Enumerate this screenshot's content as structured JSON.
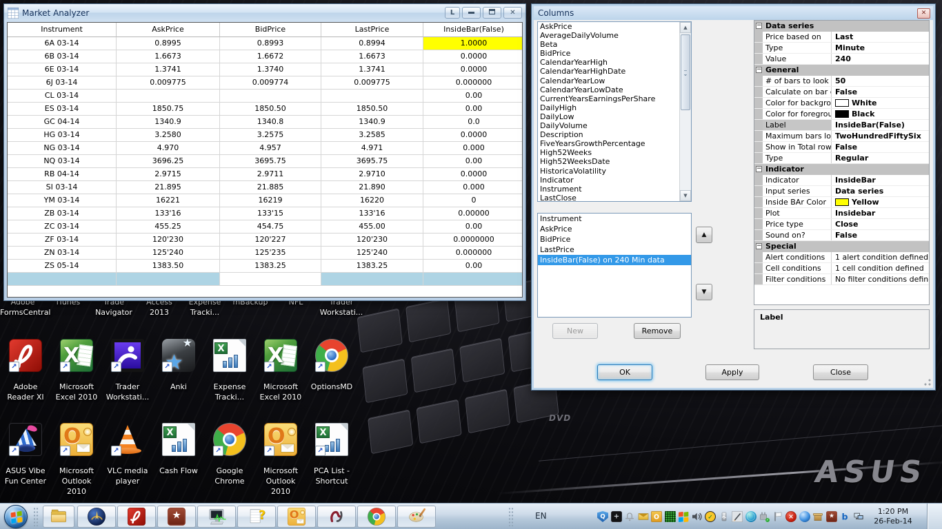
{
  "window": {
    "title": "Market Analyzer",
    "link_button_label": "L",
    "table": {
      "columns": [
        "Instrument",
        "AskPrice",
        "BidPrice",
        "LastPrice",
        "InsideBar(False)"
      ],
      "rows": [
        [
          "6A 03-14",
          "0.8995",
          "0.8993",
          "0.8994",
          "1.0000"
        ],
        [
          "6B 03-14",
          "1.6673",
          "1.6672",
          "1.6673",
          "0.0000"
        ],
        [
          "6E 03-14",
          "1.3741",
          "1.3740",
          "1.3741",
          "0.0000"
        ],
        [
          "6J 03-14",
          "0.009775",
          "0.009774",
          "0.009775",
          "0.000000"
        ],
        [
          "CL 03-14",
          "",
          "",
          "",
          "0.00"
        ],
        [
          "ES 03-14",
          "1850.75",
          "1850.50",
          "1850.50",
          "0.00"
        ],
        [
          "GC 04-14",
          "1340.9",
          "1340.8",
          "1340.9",
          "0.0"
        ],
        [
          "HG 03-14",
          "3.2580",
          "3.2575",
          "3.2585",
          "0.0000"
        ],
        [
          "NG 03-14",
          "4.970",
          "4.957",
          "4.971",
          "0.000"
        ],
        [
          "NQ 03-14",
          "3696.25",
          "3695.75",
          "3695.75",
          "0.00"
        ],
        [
          "RB 04-14",
          "2.9715",
          "2.9711",
          "2.9710",
          "0.0000"
        ],
        [
          "SI 03-14",
          "21.895",
          "21.885",
          "21.890",
          "0.000"
        ],
        [
          "YM 03-14",
          "16221",
          "16219",
          "16220",
          "0"
        ],
        [
          "ZB 03-14",
          "133'16",
          "133'15",
          "133'16",
          "0.00000"
        ],
        [
          "ZC 03-14",
          "455.25",
          "454.75",
          "455.00",
          "0.00"
        ],
        [
          "ZF 03-14",
          "120'230",
          "120'227",
          "120'230",
          "0.0000000"
        ],
        [
          "ZN 03-14",
          "125'240",
          "125'235",
          "125'240",
          "0.000000"
        ],
        [
          "ZS 05-14",
          "1383.50",
          "1383.25",
          "1383.25",
          "0.00"
        ]
      ],
      "highlight": {
        "row": 0,
        "col": 4,
        "color": "#ffff00"
      },
      "footer_blue_cols": [
        0,
        1,
        3,
        4
      ],
      "footer_color": "#aed4e4"
    }
  },
  "dialog": {
    "title": "Columns",
    "available_columns": [
      "AskPrice",
      "AverageDailyVolume",
      "Beta",
      "BidPrice",
      "CalendarYearHigh",
      "CalendarYearHighDate",
      "CalendarYearLow",
      "CalendarYearLowDate",
      "CurrentYearsEarningsPerShare",
      "DailyHigh",
      "DailyLow",
      "DailyVolume",
      "Description",
      "FiveYearsGrowthPercentage",
      "High52Weeks",
      "High52WeeksDate",
      "HistoricaVolatility",
      "Indicator",
      "Instrument",
      "LastClose"
    ],
    "selected_columns": [
      "Instrument",
      "AskPrice",
      "BidPrice",
      "LastPrice",
      "InsideBar(False) on 240 Min data"
    ],
    "selected_index": 4,
    "new_label": "New",
    "remove_label": "Remove",
    "ok_label": "OK",
    "apply_label": "Apply",
    "close_label": "Close",
    "description_title": "Label",
    "properties": [
      {
        "kind": "group",
        "name": "Data series"
      },
      {
        "kind": "prop",
        "name": "Price based on",
        "value": "Last",
        "bold": true
      },
      {
        "kind": "prop",
        "name": "Type",
        "value": "Minute",
        "bold": true
      },
      {
        "kind": "prop",
        "name": "Value",
        "value": "240",
        "bold": true
      },
      {
        "kind": "group",
        "name": "General"
      },
      {
        "kind": "prop",
        "name": "# of bars to look back",
        "value": "50",
        "bold": true
      },
      {
        "kind": "prop",
        "name": "Calculate on bar close",
        "value": "False",
        "bold": true
      },
      {
        "kind": "prop",
        "name": "Color for background",
        "value": "White",
        "bold": true,
        "swatch": "#ffffff"
      },
      {
        "kind": "prop",
        "name": "Color for foreground",
        "value": "Black",
        "bold": true,
        "swatch": "#000000"
      },
      {
        "kind": "prop",
        "name": "Label",
        "value": "InsideBar(False)",
        "bold": true,
        "selected": true
      },
      {
        "kind": "prop",
        "name": "Maximum bars look back",
        "value": "TwoHundredFiftySix",
        "bold": true
      },
      {
        "kind": "prop",
        "name": "Show in Total row",
        "value": "False",
        "bold": true
      },
      {
        "kind": "prop",
        "name": "Type",
        "value": "Regular",
        "bold": true
      },
      {
        "kind": "group",
        "name": "Indicator"
      },
      {
        "kind": "prop",
        "name": "Indicator",
        "value": "InsideBar",
        "bold": true
      },
      {
        "kind": "prop",
        "name": "Input series",
        "value": "Data series",
        "bold": true
      },
      {
        "kind": "prop",
        "name": "Inside BAr Color",
        "value": "Yellow",
        "bold": true,
        "swatch": "#ffff00"
      },
      {
        "kind": "prop",
        "name": "Plot",
        "value": "Insidebar",
        "bold": true
      },
      {
        "kind": "prop",
        "name": "Price type",
        "value": "Close",
        "bold": true
      },
      {
        "kind": "prop",
        "name": "Sound on?",
        "value": "False",
        "bold": true
      },
      {
        "kind": "group",
        "name": "Special"
      },
      {
        "kind": "prop",
        "name": "Alert conditions",
        "value": "1 alert condition defined",
        "bold": false
      },
      {
        "kind": "prop",
        "name": "Cell conditions",
        "value": "1 cell condition defined",
        "bold": false
      },
      {
        "kind": "prop",
        "name": "Filter conditions",
        "value": "No filter conditions defined",
        "bold": false
      }
    ]
  },
  "desktop": {
    "row1": [
      {
        "line1": "Adobe",
        "line2": "FormsCentral"
      },
      {
        "line1": "iTunes",
        "line2": ""
      },
      {
        "line1": "Trade",
        "line2": "Navigator"
      },
      {
        "line1": "Access 2013",
        "line2": ""
      },
      {
        "line1": "Expense",
        "line2": "Tracki..."
      },
      {
        "line1": "mBackup",
        "line2": ""
      },
      {
        "line1": "NFL",
        "line2": ""
      },
      {
        "line1": "Trader",
        "line2": "Workstati..."
      }
    ],
    "row2": [
      {
        "icon": "adobe-reader",
        "arrow": true,
        "line1": "Adobe",
        "line2": "Reader XI"
      },
      {
        "icon": "excel",
        "arrow": true,
        "line1": "Microsoft",
        "line2": "Excel 2010"
      },
      {
        "icon": "trader-workstation",
        "arrow": true,
        "line1": "Trader",
        "line2": "Workstati..."
      },
      {
        "icon": "anki",
        "arrow": true,
        "line1": "Anki",
        "line2": ""
      },
      {
        "icon": "excel-document",
        "arrow": false,
        "line1": "Expense",
        "line2": "Tracki..."
      },
      {
        "icon": "excel",
        "arrow": true,
        "line1": "Microsoft",
        "line2": "Excel 2010"
      },
      {
        "icon": "chrome",
        "arrow": true,
        "line1": "OptionsMD",
        "line2": ""
      }
    ],
    "row3": [
      {
        "icon": "asus-vibe",
        "arrow": true,
        "line1": "ASUS Vibe",
        "line2": "Fun Center"
      },
      {
        "icon": "outlook",
        "arrow": true,
        "line1": "Microsoft",
        "line2": "Outlook 2010"
      },
      {
        "icon": "vlc",
        "arrow": true,
        "line1": "VLC media",
        "line2": "player"
      },
      {
        "icon": "excel-document",
        "arrow": false,
        "line1": "Cash Flow",
        "line2": ""
      },
      {
        "icon": "chrome",
        "arrow": true,
        "line1": "Google",
        "line2": "Chrome"
      },
      {
        "icon": "outlook",
        "arrow": true,
        "line1": "Microsoft",
        "line2": "Outlook 2010"
      },
      {
        "icon": "excel-document",
        "arrow": true,
        "line1": "PCA List -",
        "line2": "Shortcut"
      }
    ],
    "asus_logo": "ASUS",
    "dvd_label": "DVD"
  },
  "taskbar": {
    "buttons": [
      {
        "icon": "explorer-folder"
      },
      {
        "icon": "trade-navigator"
      },
      {
        "icon": "adobe-reader"
      },
      {
        "icon": "wunderlist"
      },
      {
        "icon": "system-monitor"
      },
      {
        "icon": "help-document"
      },
      {
        "icon": "outlook"
      },
      {
        "icon": "ninjatrader"
      },
      {
        "icon": "chrome"
      },
      {
        "icon": "paint"
      }
    ],
    "language_indicator": "EN",
    "tray_icons": [
      "search-shield",
      "crosshair-grid",
      "bell",
      "mail-envelope",
      "outlook-badge",
      "green-grid",
      "windows-update",
      "volume",
      "norton",
      "usb-device",
      "tablet-pen",
      "globe",
      "safely-remove",
      "action-flag",
      "error-badge",
      "blue-sphere",
      "package-box",
      "wunderlist",
      "bing",
      "network-display"
    ],
    "clock": {
      "time": "1:20 PM",
      "date": "26-Feb-14"
    }
  }
}
